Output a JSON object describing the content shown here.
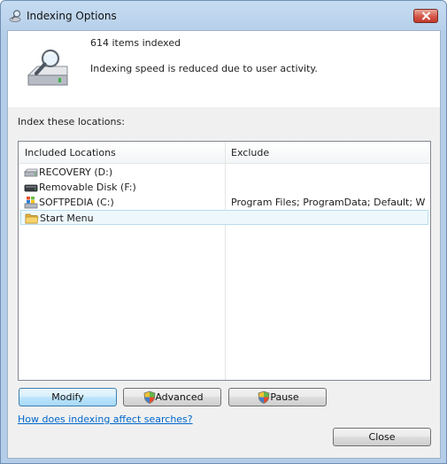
{
  "window": {
    "title": "Indexing Options"
  },
  "status": {
    "items_indexed": "614 items indexed",
    "speed_message": "Indexing speed is reduced due to user activity."
  },
  "locations": {
    "heading": "Index these locations:",
    "columns": [
      "Included Locations",
      "Exclude"
    ],
    "rows": [
      {
        "name": "RECOVERY (D:)",
        "exclude": "",
        "icon": "drive-icon"
      },
      {
        "name": "Removable Disk (F:)",
        "exclude": "",
        "icon": "removable-drive-icon"
      },
      {
        "name": "SOFTPEDIA (C:)",
        "exclude": "Program Files; ProgramData; Default; Win…",
        "icon": "windows-drive-icon"
      },
      {
        "name": "Start Menu",
        "exclude": "",
        "icon": "folder-icon",
        "selected": true
      }
    ]
  },
  "buttons": {
    "modify": "Modify",
    "advanced": "Advanced",
    "pause": "Pause",
    "close": "Close"
  },
  "help_link": "How does indexing affect searches?",
  "colors": {
    "link": "#0066cc",
    "selection": "#eef8fc"
  }
}
